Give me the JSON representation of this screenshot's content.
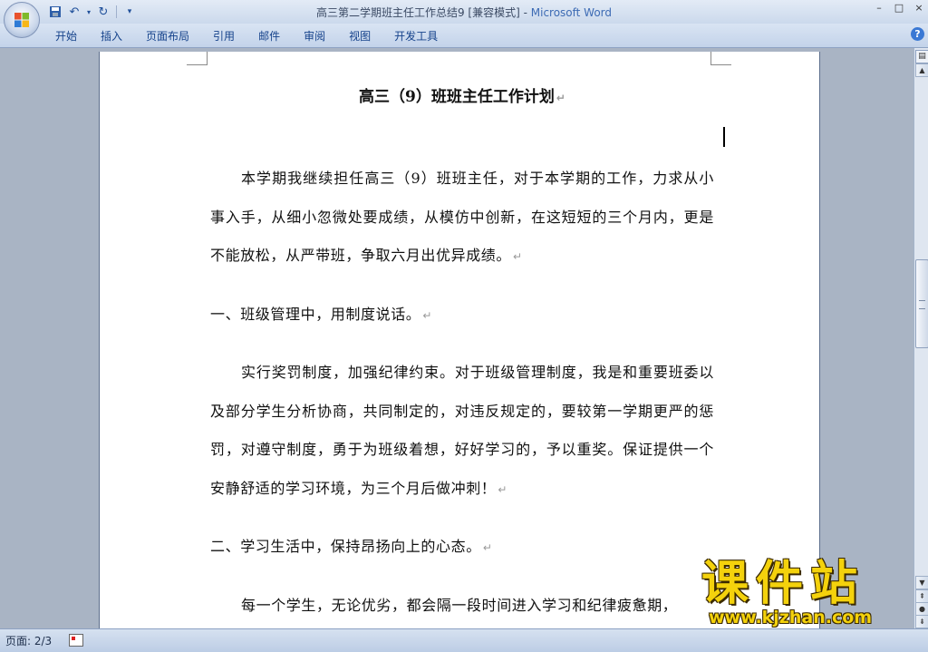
{
  "window": {
    "doc_title": "高三第二学期班主任工作总结9 [兼容模式]",
    "separator": " - ",
    "app_name": "Microsoft Word",
    "controls": [
      "–",
      "□",
      "×"
    ]
  },
  "quick_access": {
    "items": [
      "save-icon",
      "undo-icon",
      "dropdown-icon",
      "redo-icon",
      "customize-icon"
    ]
  },
  "ribbon": {
    "tabs": [
      {
        "label": "开始"
      },
      {
        "label": "插入"
      },
      {
        "label": "页面布局"
      },
      {
        "label": "引用"
      },
      {
        "label": "邮件"
      },
      {
        "label": "审阅"
      },
      {
        "label": "视图"
      },
      {
        "label": "开发工具"
      }
    ],
    "help": "?"
  },
  "document": {
    "title": "高三（9）班班主任工作计划",
    "paragraphs": [
      {
        "text": "本学期我继续担任高三（9）班班主任，对于本学期的工作，力求从小事入手，从细小忽微处要成绩，从模仿中创新，在这短短的三个月内，更是不能放松，从严带班，争取六月出优异成绩。",
        "indent": true
      },
      {
        "text": "一、班级管理中，用制度说话。",
        "indent": false
      },
      {
        "text": "实行奖罚制度，加强纪律约束。对于班级管理制度，我是和重要班委以及部分学生分析协商，共同制定的，对违反规定的，要较第一学期更严的惩罚，对遵守制度，勇于为班级着想，好好学习的，予以重奖。保证提供一个安静舒适的学习环境，为三个月后做冲刺！",
        "indent": true
      },
      {
        "text": "二、学习生活中，保持昂扬向上的心态。",
        "indent": false
      },
      {
        "text": "每一个学生，无论优劣，都会隔一段时间进入学习和纪律疲惫期，",
        "indent": true
      }
    ],
    "paragraph_mark": "↵"
  },
  "status": {
    "page": "页面: 2/3"
  },
  "watermark": {
    "text": "课件站",
    "url": "www.kjzhan.com"
  }
}
